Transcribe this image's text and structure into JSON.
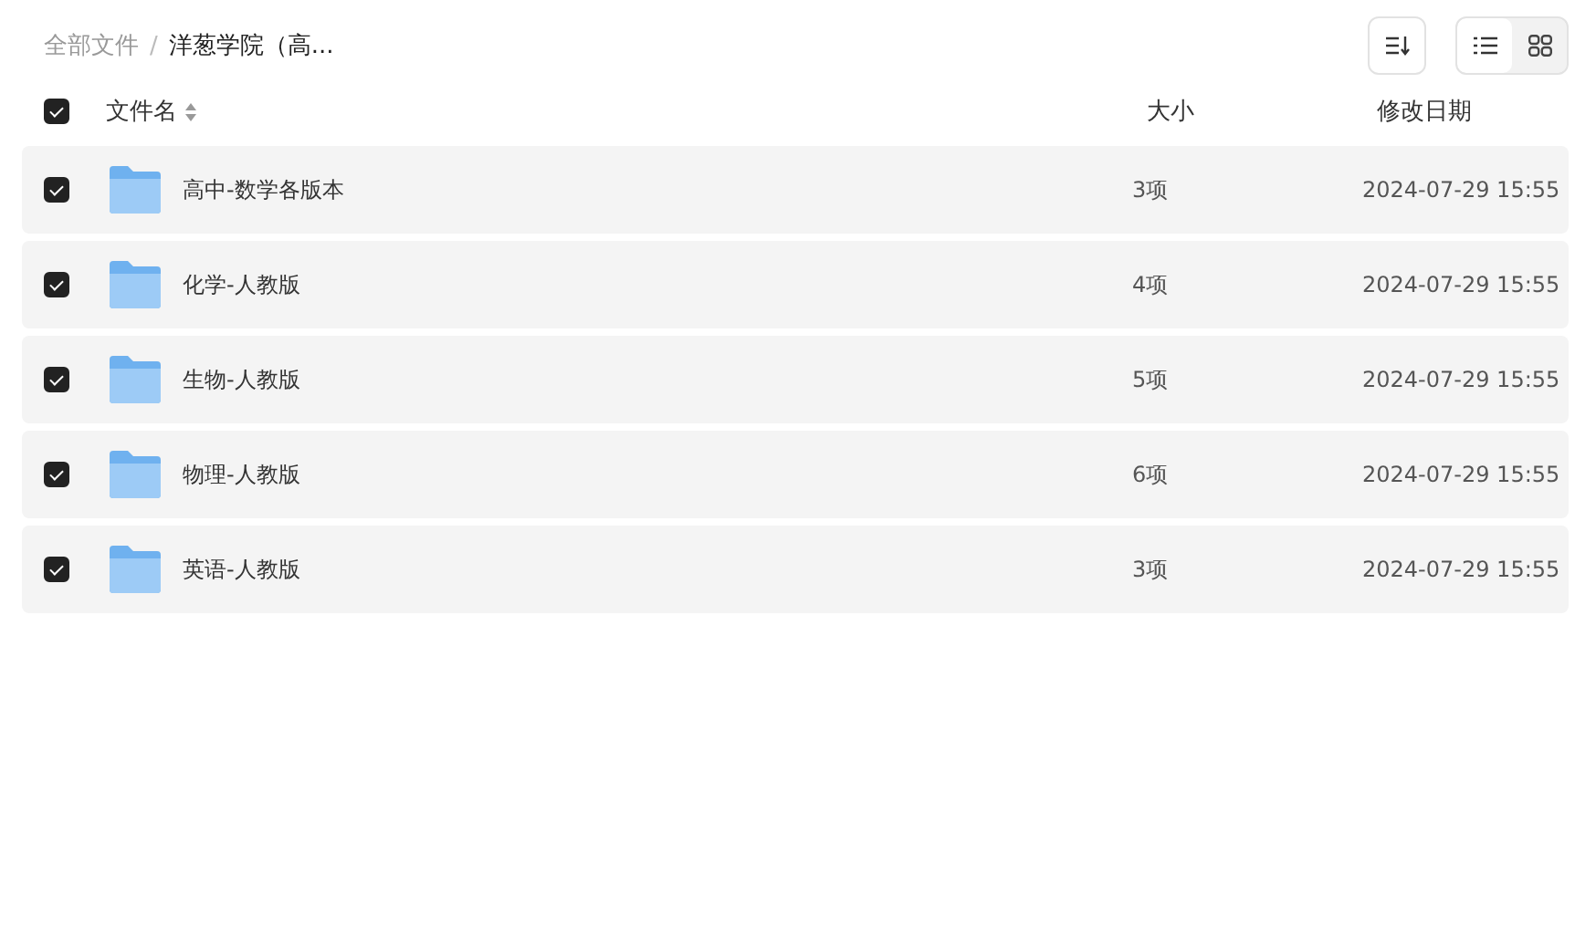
{
  "breadcrumb": [
    {
      "label": "全部文件",
      "current": false
    },
    {
      "label": "洋葱学院（高...",
      "current": true
    }
  ],
  "breadcrumb_separator": "/",
  "view_modes": [
    {
      "kind": "list",
      "selected": true
    },
    {
      "kind": "grid",
      "selected": false
    }
  ],
  "header": {
    "checked": true,
    "name": "文件名",
    "size": "大小",
    "date": "修改日期"
  },
  "rows": [
    {
      "name": "高中-数学各版本",
      "size": "3项",
      "date": "2024-07-29 15:55",
      "checked": true
    },
    {
      "name": "化学-人教版",
      "size": "4项",
      "date": "2024-07-29 15:55",
      "checked": true
    },
    {
      "name": "生物-人教版",
      "size": "5项",
      "date": "2024-07-29 15:55",
      "checked": true
    },
    {
      "name": "物理-人教版",
      "size": "6项",
      "date": "2024-07-29 15:55",
      "checked": true
    },
    {
      "name": "英语-人教版",
      "size": "3项",
      "date": "2024-07-29 15:55",
      "checked": true
    }
  ]
}
